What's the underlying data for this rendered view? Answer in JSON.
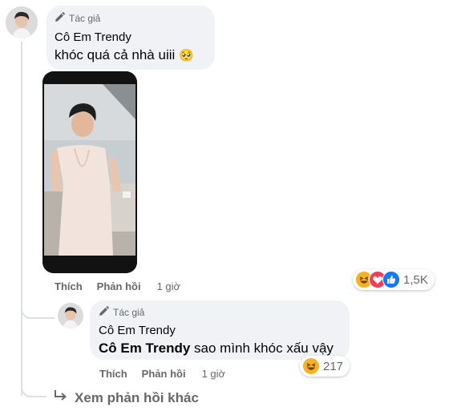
{
  "comment": {
    "badge": "Tác giả",
    "author": "Cô Em Trendy",
    "text": "khóc quá cả nhà uiii",
    "emoji": "🥺",
    "actions": {
      "like": "Thích",
      "reply": "Phản hồi",
      "time": "1 giờ"
    },
    "reactions": {
      "icons": [
        "haha",
        "love",
        "like"
      ],
      "count": "1,5K"
    }
  },
  "reply": {
    "badge": "Tác giả",
    "author": "Cô Em Trendy",
    "mention": "Cô Em Trendy",
    "text": " sao mình khóc xấu vậy",
    "actions": {
      "like": "Thích",
      "reply": "Phản hồi",
      "time": "1 giờ"
    },
    "reactions": {
      "icons": [
        "haha"
      ],
      "count": "217"
    }
  },
  "more_replies": {
    "label": "Xem phản hồi khác"
  },
  "colors": {
    "love": "#f33e58",
    "like": "#1877f2",
    "haha": "#f7b125",
    "secondary_text": "#65676b",
    "bubble": "#f0f2f5"
  }
}
